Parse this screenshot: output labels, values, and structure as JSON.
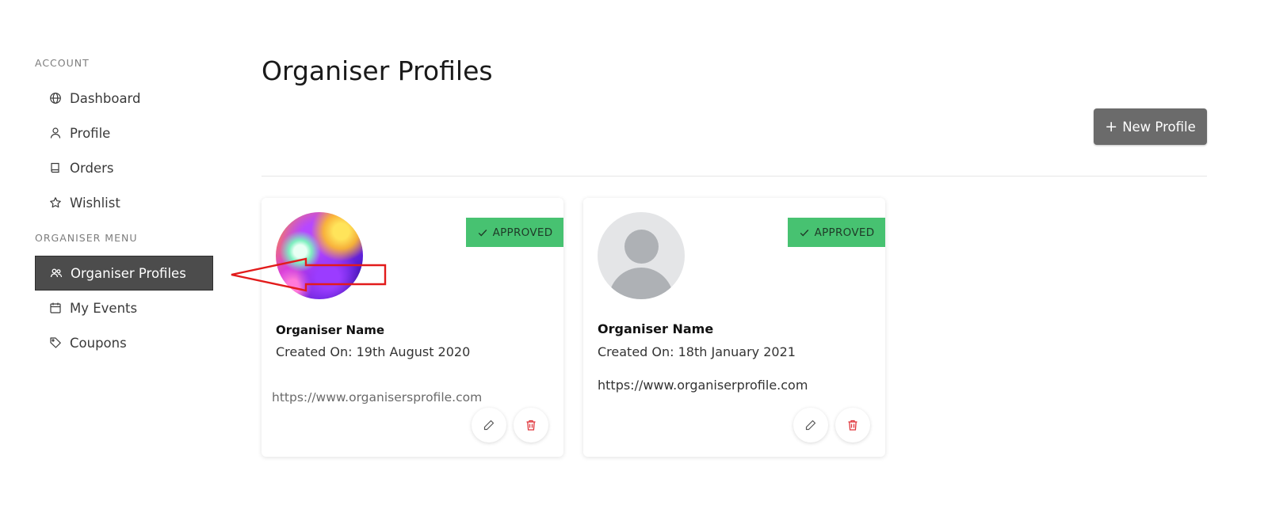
{
  "sidebar": {
    "account_title": "ACCOUNT",
    "account_items": [
      {
        "label": "Dashboard",
        "icon": "globe-icon"
      },
      {
        "label": "Profile",
        "icon": "user-icon"
      },
      {
        "label": "Orders",
        "icon": "book-icon"
      },
      {
        "label": "Wishlist",
        "icon": "star-icon"
      }
    ],
    "organiser_title": "ORGANISER MENU",
    "organiser_items": [
      {
        "label": "Organiser Profiles",
        "icon": "users-icon",
        "active": true
      },
      {
        "label": "My Events",
        "icon": "calendar-icon"
      },
      {
        "label": "Coupons",
        "icon": "tag-icon"
      }
    ]
  },
  "main": {
    "title": "Organiser Profiles",
    "new_profile_button": "New Profile",
    "new_profile_icon": "plus-icon"
  },
  "cards": [
    {
      "badge": "APPROVED",
      "avatar": "photo",
      "name": "Organiser Name",
      "created": "Created On: 19th August 2020",
      "url": "https://www.organisersprofile.com"
    },
    {
      "badge": "APPROVED",
      "avatar": "placeholder",
      "name": "Organiser Name",
      "created": "Created On: 18th January 2021",
      "url": "https://www.organiserprofile.com"
    }
  ],
  "colors": {
    "active_nav_bg": "#4c4c4c",
    "badge_green": "#47c271",
    "button_gray": "#6b6b6b",
    "delete_red": "#e0353b",
    "annotation_red": "#e21b1b"
  }
}
